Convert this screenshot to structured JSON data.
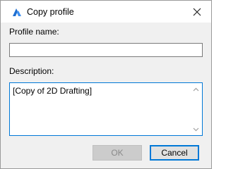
{
  "window": {
    "title": "Copy profile",
    "icon": "bricscad-logo-icon",
    "accent_color": "#0078d7"
  },
  "form": {
    "profile_name_label": "Profile name:",
    "profile_name_value": "",
    "description_label": "Description:",
    "description_value": "[Copy of 2D Drafting]"
  },
  "buttons": {
    "ok_label": "OK",
    "ok_enabled": false,
    "cancel_label": "Cancel"
  }
}
